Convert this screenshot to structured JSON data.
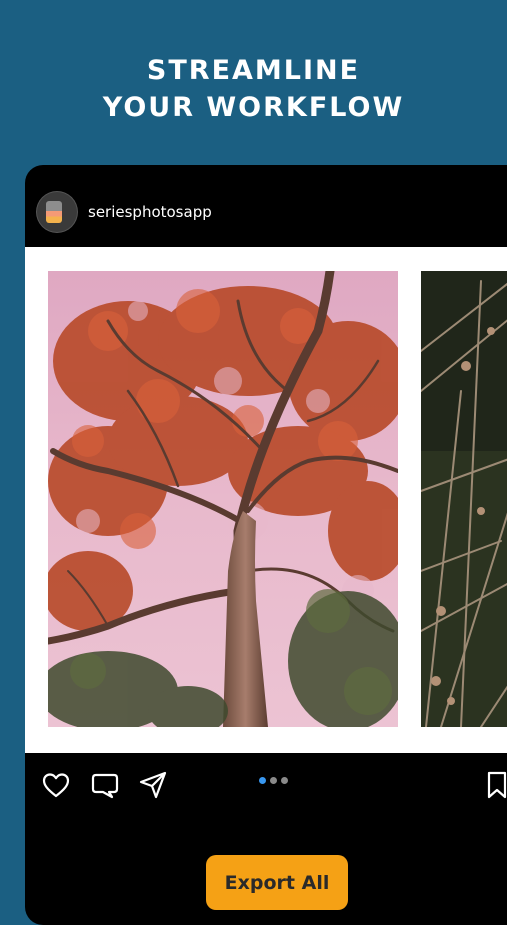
{
  "headline": {
    "line1": "STREAMLINE",
    "line2": "YOUR WORKFLOW"
  },
  "post": {
    "username": "seriesphotosapp",
    "avatar_icon": "series-app-logo-icon",
    "photos": [
      {
        "subject": "autumn-tree-pink-sky"
      },
      {
        "subject": "dried-grass-stems"
      }
    ],
    "carousel": {
      "count": 3,
      "active_index": 0
    },
    "actions": {
      "like_icon": "heart-icon",
      "comment_icon": "comment-icon",
      "share_icon": "send-icon",
      "save_icon": "bookmark-icon"
    }
  },
  "export_button": {
    "label": "Export All"
  },
  "colors": {
    "background": "#1b5f82",
    "accent": "#f5a115",
    "active_dot": "#3897f0"
  }
}
